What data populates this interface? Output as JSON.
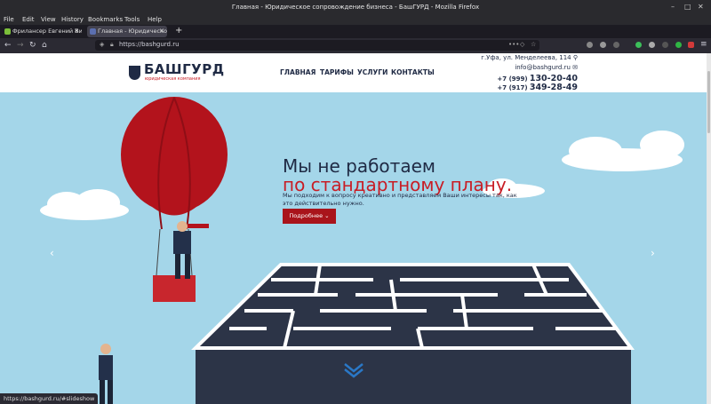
{
  "window": {
    "title": "Главная - Юридическое сопровождение бизнеса - БашГУРД - Mozilla Firefox"
  },
  "menu": [
    "File",
    "Edit",
    "View",
    "History",
    "Bookmarks",
    "Tools",
    "Help"
  ],
  "tabs": [
    {
      "label": "Фрилансер Евгений Ви"
    },
    {
      "label": "Главная - Юридическое"
    }
  ],
  "url": "https://bashgurd.ru",
  "site": {
    "logo_name": "БАШГУРД",
    "logo_tag": "юридическая компания",
    "nav": [
      "ГЛАВНАЯ",
      "ТАРИФЫ",
      "УСЛУГИ",
      "КОНТАКТЫ"
    ],
    "address": "г.Уфа, ул. Менделеева, 114",
    "email": "info@bashgurd.ru",
    "phone1_code": "+7 (999)",
    "phone1_num": "130-20-40",
    "phone2_code": "+7 (917)",
    "phone2_num": "349-28-49"
  },
  "hero": {
    "line1": "Мы не работаем",
    "line2": "по стандартному плану.",
    "text": "Мы подходим к вопросу креативно и представляем Ваши интересы так, как это действительно нужно.",
    "button": "Подробнее"
  },
  "status_url": "https://bashgurd.ru/#slideshow",
  "colors": {
    "accent": "#c81d25",
    "dark": "#1f2a44",
    "sky": "#a4d6e9"
  }
}
